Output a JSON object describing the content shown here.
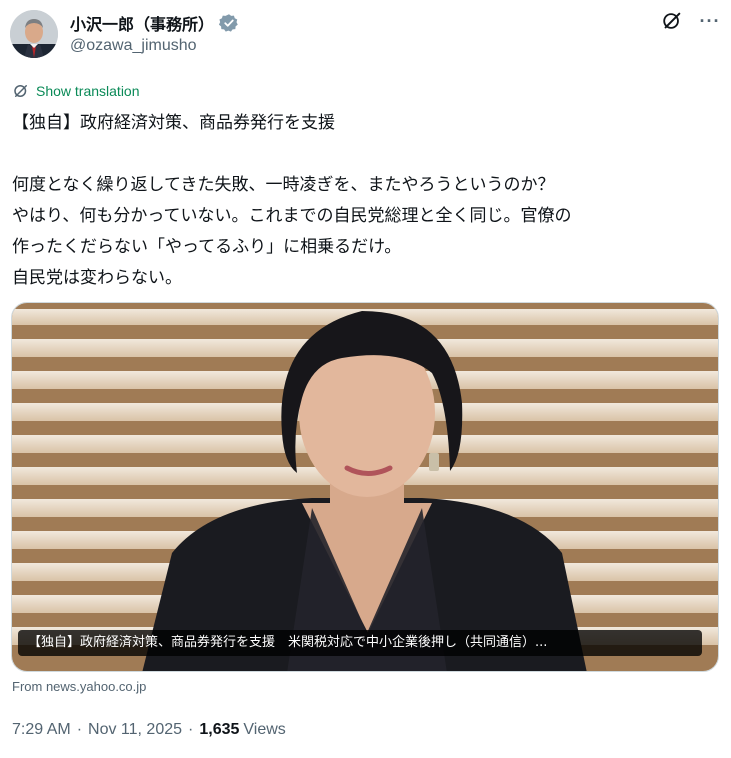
{
  "author": {
    "display_name": "小沢一郎（事務所）",
    "handle": "@ozawa_jimusho",
    "verified_color": "#829aab"
  },
  "header": {
    "grok_icon": "grok-icon",
    "more_label": "···"
  },
  "translation": {
    "label": "Show translation",
    "color": "#0a8a57"
  },
  "tweet": {
    "lines": [
      "【独自】政府経済対策、商品券発行を支援",
      "",
      "何度となく繰り返してきた失敗、一時凌ぎを、またやろうというのか？",
      "やはり、何も分かっていない。これまでの自民党総理と全く同じ。官僚の",
      "作ったくだらない「やってるふり」に相乗るだけ。",
      "自民党は変わらない。"
    ]
  },
  "card": {
    "caption": "【独自】政府経済対策、商品券発行を支援　米関税対応で中小企業後押し（共同通信）...",
    "source": "From news.yahoo.co.jp"
  },
  "meta": {
    "time": "7:29 AM",
    "date": "Nov 11, 2025",
    "views_count": "1,635",
    "views_label": "Views"
  }
}
